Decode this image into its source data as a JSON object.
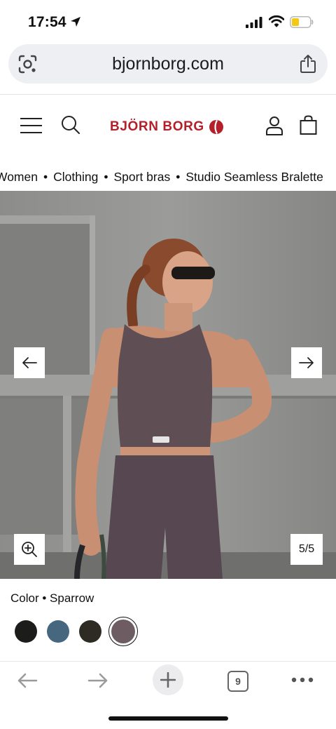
{
  "status_bar": {
    "time": "17:54"
  },
  "browser": {
    "url": "bjornborg.com"
  },
  "site": {
    "brand": "BJÖRN BORG",
    "brand_color": "#b51f2a"
  },
  "breadcrumb": {
    "items": [
      "Women",
      "Clothing",
      "Sport bras",
      "Studio Seamless Bralette"
    ],
    "separator": "•"
  },
  "gallery": {
    "counter": "5/5"
  },
  "product": {
    "color_label": "Color • Sparrow",
    "swatches": [
      {
        "name": "black",
        "color": "#1c1c1b"
      },
      {
        "name": "blue",
        "color": "#47677e"
      },
      {
        "name": "dark-olive",
        "color": "#2e2b25"
      },
      {
        "name": "sparrow",
        "color": "#6e5c63",
        "selected": true
      }
    ]
  },
  "toolbar": {
    "tab_count": "9"
  },
  "icons": [
    "location-arrow-icon",
    "signal-icon",
    "wifi-icon",
    "battery-icon",
    "lens-icon",
    "share-icon",
    "menu-icon",
    "search-icon",
    "account-icon",
    "bag-icon",
    "arrow-left-icon",
    "arrow-right-icon",
    "zoom-in-icon",
    "back-icon",
    "forward-icon",
    "plus-icon",
    "more-icon"
  ]
}
